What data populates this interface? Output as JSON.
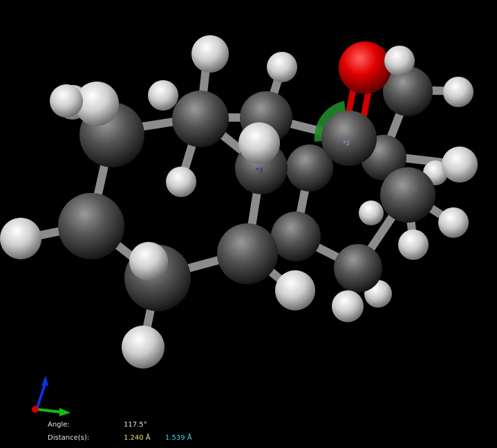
{
  "viewer": {
    "background": "#000000",
    "atom_labels": {
      "a2": "*2",
      "a3": "*3"
    },
    "colors": {
      "carbon": "#4a4a4a",
      "hydrogen": "#d8d8d8",
      "oxygen": "#e00000",
      "bond": "#8a8a8a",
      "angle_arc": "#1f8a2a",
      "axis_x": "#d40000",
      "axis_y": "#10c010",
      "axis_z": "#1030e0",
      "dist1": "#f0e070",
      "dist2": "#40d8e0"
    }
  },
  "measurement": {
    "angle_label": "Angle:",
    "angle_value": "117.5°",
    "distance_label": "Distance(s):",
    "distance_1": "1.240 Å",
    "distance_2": "1.539 Å"
  }
}
